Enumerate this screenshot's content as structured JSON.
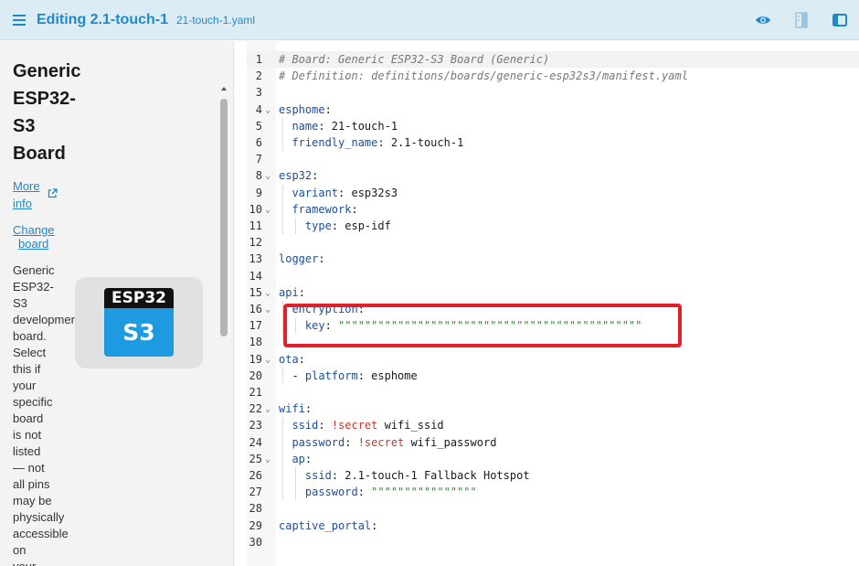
{
  "header": {
    "title": "Editing 2.1-touch-1",
    "filename": "21-touch-1.yaml",
    "icons": [
      "menu-icon",
      "eye-icon",
      "panel-toggle-icon",
      "sidebar-icon"
    ]
  },
  "sidebar": {
    "board_title_lines": [
      "Generic",
      "ESP32-",
      "S3",
      "Board"
    ],
    "more_info_lines": [
      "More",
      "info"
    ],
    "change_board_lines": [
      "Change",
      "board"
    ],
    "description_lines": [
      "Generic",
      "ESP32-",
      "S3",
      "developmer",
      "board.",
      "Select",
      "this if",
      "your",
      "specific",
      "board",
      "is not",
      "listed",
      "— not",
      "all pins",
      "may be",
      "physically",
      "accessible",
      "on",
      "your"
    ],
    "chip_top": "ESP32",
    "chip_bottom": "S3"
  },
  "editor": {
    "active_line": 1,
    "lines": [
      {
        "n": "1",
        "text": "# Board: Generic ESP32-S3 Board (Generic)"
      },
      {
        "n": "2",
        "text": "# Definition: definitions/boards/generic-esp32s3/manifest.yaml"
      },
      {
        "n": "3",
        "text": ""
      },
      {
        "n": "4",
        "text": "esphome:"
      },
      {
        "n": "5",
        "text": "  name: 21-touch-1"
      },
      {
        "n": "6",
        "text": "  friendly_name: 2.1-touch-1"
      },
      {
        "n": "7",
        "text": ""
      },
      {
        "n": "8",
        "text": "esp32:"
      },
      {
        "n": "9",
        "text": "  variant: esp32s3"
      },
      {
        "n": "10",
        "text": "  framework:"
      },
      {
        "n": "11",
        "text": "    type: esp-idf"
      },
      {
        "n": "12",
        "text": ""
      },
      {
        "n": "13",
        "text": "logger:"
      },
      {
        "n": "14",
        "text": ""
      },
      {
        "n": "15",
        "text": "api:"
      },
      {
        "n": "16",
        "text": "  encryption:"
      },
      {
        "n": "17",
        "text": "    key: \"\"\"\"\"\"\"\"\"\"\"\"\"\"\"\"\"\"\"\"\"\"\"\"\"\"\"\"\"\"\"\"\"\"\"\"\"\"\"\"\"\"\"\"\"\""
      },
      {
        "n": "18",
        "text": ""
      },
      {
        "n": "19",
        "text": "ota:"
      },
      {
        "n": "20",
        "text": "  - platform: esphome"
      },
      {
        "n": "21",
        "text": ""
      },
      {
        "n": "22",
        "text": "wifi:"
      },
      {
        "n": "23",
        "text": "  ssid: !secret wifi_ssid"
      },
      {
        "n": "24",
        "text": "  password: !secret wifi_password"
      },
      {
        "n": "25",
        "text": "  ap:"
      },
      {
        "n": "26",
        "text": "    ssid: 2.1-touch-1 Fallback Hotspot"
      },
      {
        "n": "27",
        "text": "    password: \"\"\"\"\"\"\"\"\"\"\"\"\"\"\"\""
      },
      {
        "n": "28",
        "text": ""
      },
      {
        "n": "29",
        "text": "captive_portal:"
      },
      {
        "n": "30",
        "text": ""
      }
    ],
    "fold_lines": [
      "4",
      "8",
      "10",
      "15",
      "16",
      "19",
      "22",
      "25"
    ]
  },
  "colors": {
    "accent": "#1f88c8",
    "highlight": "#e0212b",
    "key": "#1a4fa0",
    "secret_tag": "#c0392b",
    "string_dots": "#2e8b2e"
  }
}
